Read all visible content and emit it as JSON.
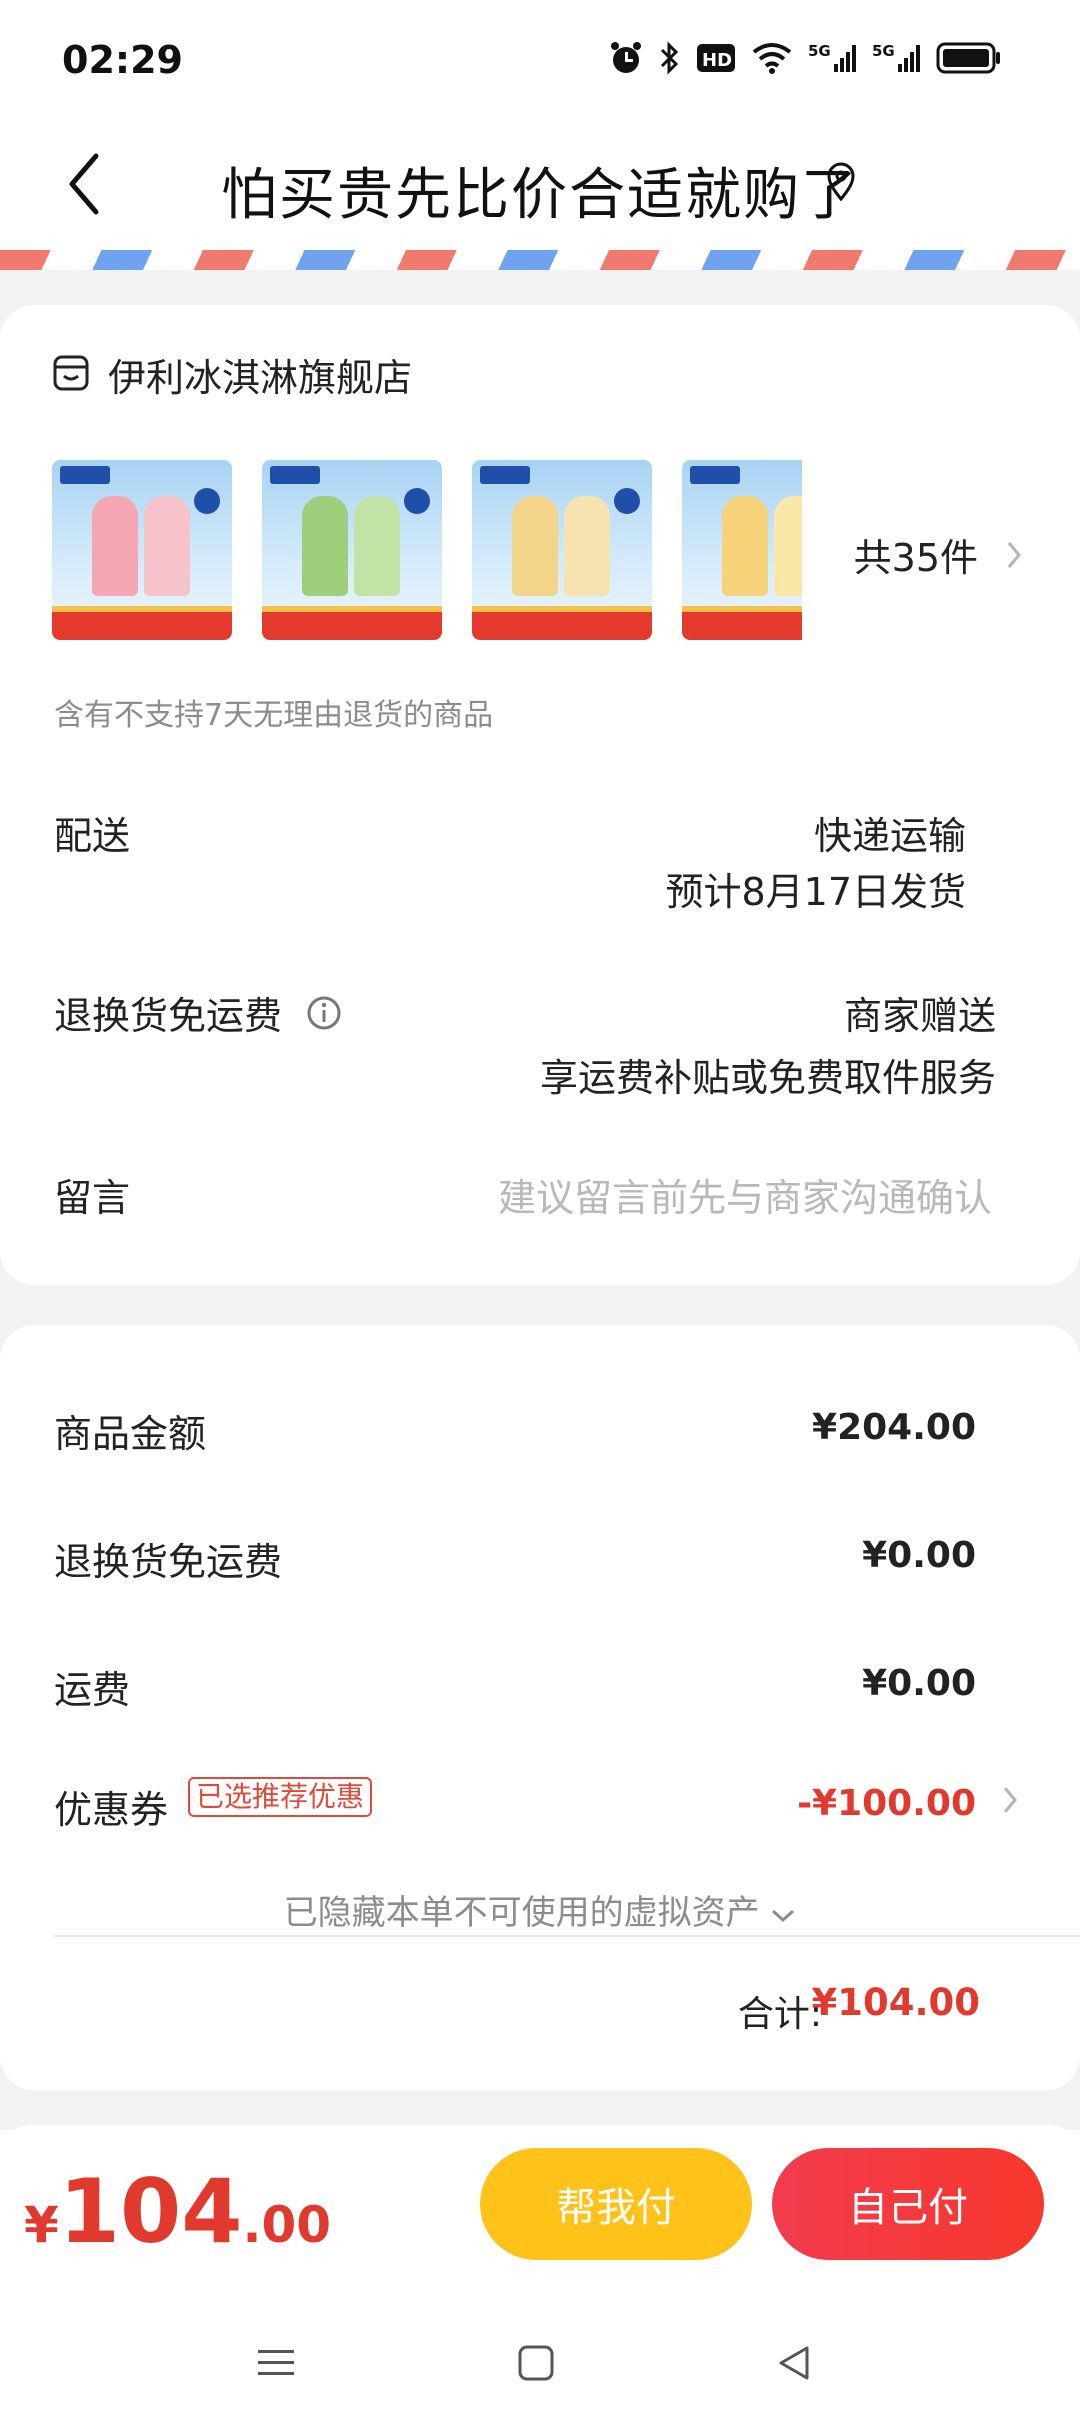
{
  "status_bar": {
    "time": "02:29",
    "icons": [
      "alarm-icon",
      "bluetooth-icon",
      "hd-icon",
      "wifi-icon",
      "signal-5g-icon",
      "signal-5g-icon",
      "battery-icon"
    ],
    "hd_label": "HD",
    "net1": "5G",
    "net2": "5G"
  },
  "header": {
    "title": "怕买贵先比价合适就购了"
  },
  "store": {
    "name": "伊利冰淇淋旗舰店",
    "count_label": "共35件",
    "notice": "含有不支持7天无理由退货的商品"
  },
  "delivery": {
    "label": "配送",
    "method": "快递运输",
    "estimate": "预计8月17日发货"
  },
  "return_shipping": {
    "label": "退换货免运费",
    "value": "商家赠送",
    "detail": "享运费补贴或免费取件服务"
  },
  "message": {
    "label": "留言",
    "placeholder": "建议留言前先与商家沟通确认"
  },
  "totals": {
    "goods_label": "商品金额",
    "goods_value": "¥204.00",
    "return_label": "退换货免运费",
    "return_value": "¥0.00",
    "freight_label": "运费",
    "freight_value": "¥0.00",
    "coupon_label": "优惠券",
    "coupon_tag": "已选推荐优惠",
    "coupon_value": "-¥100.00",
    "hidden_assets": "已隐藏本单不可使用的虚拟资产",
    "sum_label": "合计:",
    "sum_value": "¥104.00"
  },
  "footer": {
    "currency": "¥",
    "amount_int": "104",
    "amount_dec": ".00",
    "help_pay": "帮我付",
    "self_pay": "自己付"
  },
  "colors": {
    "accent": "#e0392d",
    "help_btn": "#ffc218",
    "self_btn": "#f23b4e"
  }
}
